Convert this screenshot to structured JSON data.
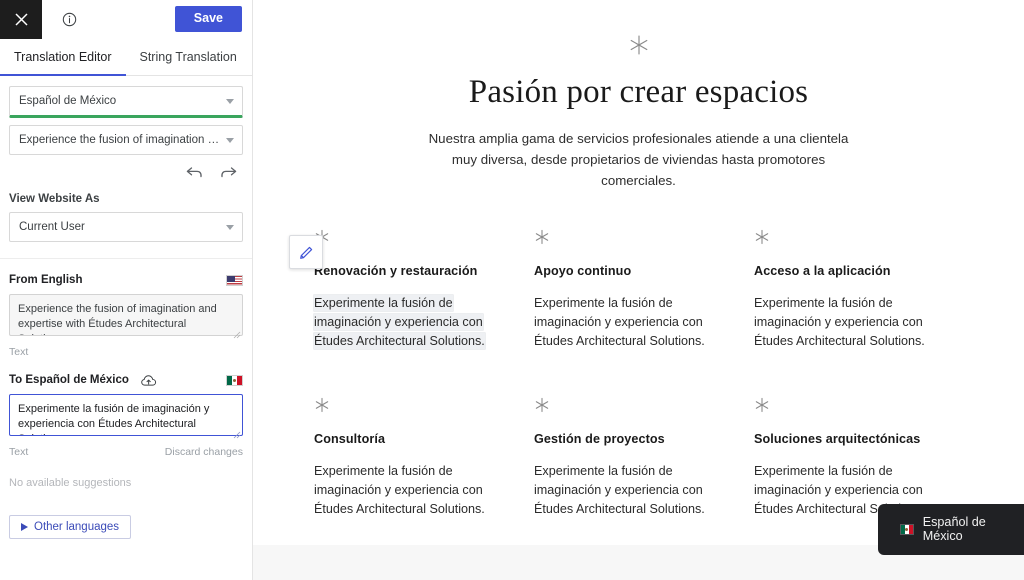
{
  "sidebar": {
    "topbar": {
      "close_icon": "close-icon",
      "info_icon": "info-icon",
      "save_label": "Save"
    },
    "tabs": [
      {
        "label": "Translation Editor",
        "active": true
      },
      {
        "label": "String Translation",
        "active": false
      }
    ],
    "language_select": {
      "value": "Español de México",
      "icon": "chevron-down-icon"
    },
    "string_select": {
      "value": "Experience the fusion of imagination and expertis…",
      "icon": "chevron-down-icon"
    },
    "history": {
      "undo_icon": "undo-icon",
      "redo_icon": "redo-icon"
    },
    "view_website_as": {
      "label": "View Website As",
      "value": "Current User"
    },
    "source": {
      "heading": "From English",
      "flag": "flag-united-states",
      "text": "Experience the fusion of imagination and expertise with Études Architectural Solutions.",
      "meta_label": "Text"
    },
    "target": {
      "heading": "To Español de México",
      "cloud_icon": "cloud-upload-icon",
      "flag": "flag-mexico",
      "text": "Experimente la fusión de imaginación y experiencia con Études Architectural Solutions.",
      "meta_label": "Text",
      "discard_label": "Discard changes"
    },
    "suggestions_empty": "No available suggestions",
    "other_languages_label": "Other languages"
  },
  "preview": {
    "hero": {
      "icon": "asterisk-icon",
      "title": "Pasión por crear espacios",
      "subtitle": "Nuestra amplia gama de servicios profesionales atiende a una clientela muy diversa, desde propietarios de viviendas hasta promotores comerciales."
    },
    "cards": [
      {
        "icon": "asterisk-icon",
        "title": "Renovación y restauración",
        "body_lines": [
          "Experimente la fusión de",
          "imaginación y experiencia con",
          "Études Architectural Solutions."
        ],
        "highlighted": true,
        "edit_icon": "pencil-icon"
      },
      {
        "icon": "asterisk-icon",
        "title": "Apoyo continuo",
        "body_lines": [
          "Experimente la fusión de",
          "imaginación y experiencia con",
          "Études Architectural Solutions."
        ],
        "highlighted": false
      },
      {
        "icon": "asterisk-icon",
        "title": "Acceso a la aplicación",
        "body_lines": [
          "Experimente la fusión de",
          "imaginación y experiencia con",
          "Études Architectural Solutions."
        ],
        "highlighted": false
      },
      {
        "icon": "asterisk-icon",
        "title": "Consultoría",
        "body_lines": [
          "Experimente la fusión de",
          "imaginación y experiencia con",
          "Études Architectural Solutions."
        ],
        "highlighted": false
      },
      {
        "icon": "asterisk-icon",
        "title": "Gestión de proyectos",
        "body_lines": [
          "Experimente la fusión de",
          "imaginación y experiencia con",
          "Études Architectural Solutions."
        ],
        "highlighted": false
      },
      {
        "icon": "asterisk-icon",
        "title": "Soluciones arquitectónicas",
        "body_lines": [
          "Experimente la fusión de",
          "imaginación y experiencia con",
          "Études Architectural Solutions."
        ],
        "highlighted": false
      }
    ],
    "language_badge": {
      "label": "Español de México",
      "flag": "flag-mexico"
    }
  },
  "colors": {
    "accent_blue": "#4054d6",
    "active_underline_green": "#3aa55d",
    "badge_dark": "#202124",
    "save_button": "#4054d6"
  }
}
